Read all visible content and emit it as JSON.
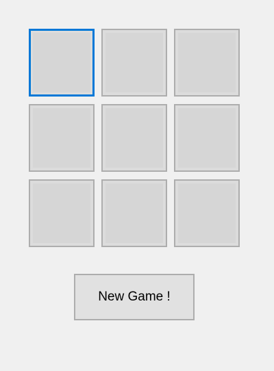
{
  "board": {
    "cells": [
      {
        "mark": "",
        "focused": true
      },
      {
        "mark": "",
        "focused": false
      },
      {
        "mark": "",
        "focused": false
      },
      {
        "mark": "",
        "focused": false
      },
      {
        "mark": "",
        "focused": false
      },
      {
        "mark": "",
        "focused": false
      },
      {
        "mark": "",
        "focused": false
      },
      {
        "mark": "",
        "focused": false
      },
      {
        "mark": "",
        "focused": false
      }
    ]
  },
  "controls": {
    "new_game_label": "New Game !"
  },
  "colors": {
    "background": "#f0f0f0",
    "cell_fill": "#d6d6d6",
    "cell_border": "#adadad",
    "focus_border": "#0078d7",
    "button_fill": "#e1e1e1"
  }
}
